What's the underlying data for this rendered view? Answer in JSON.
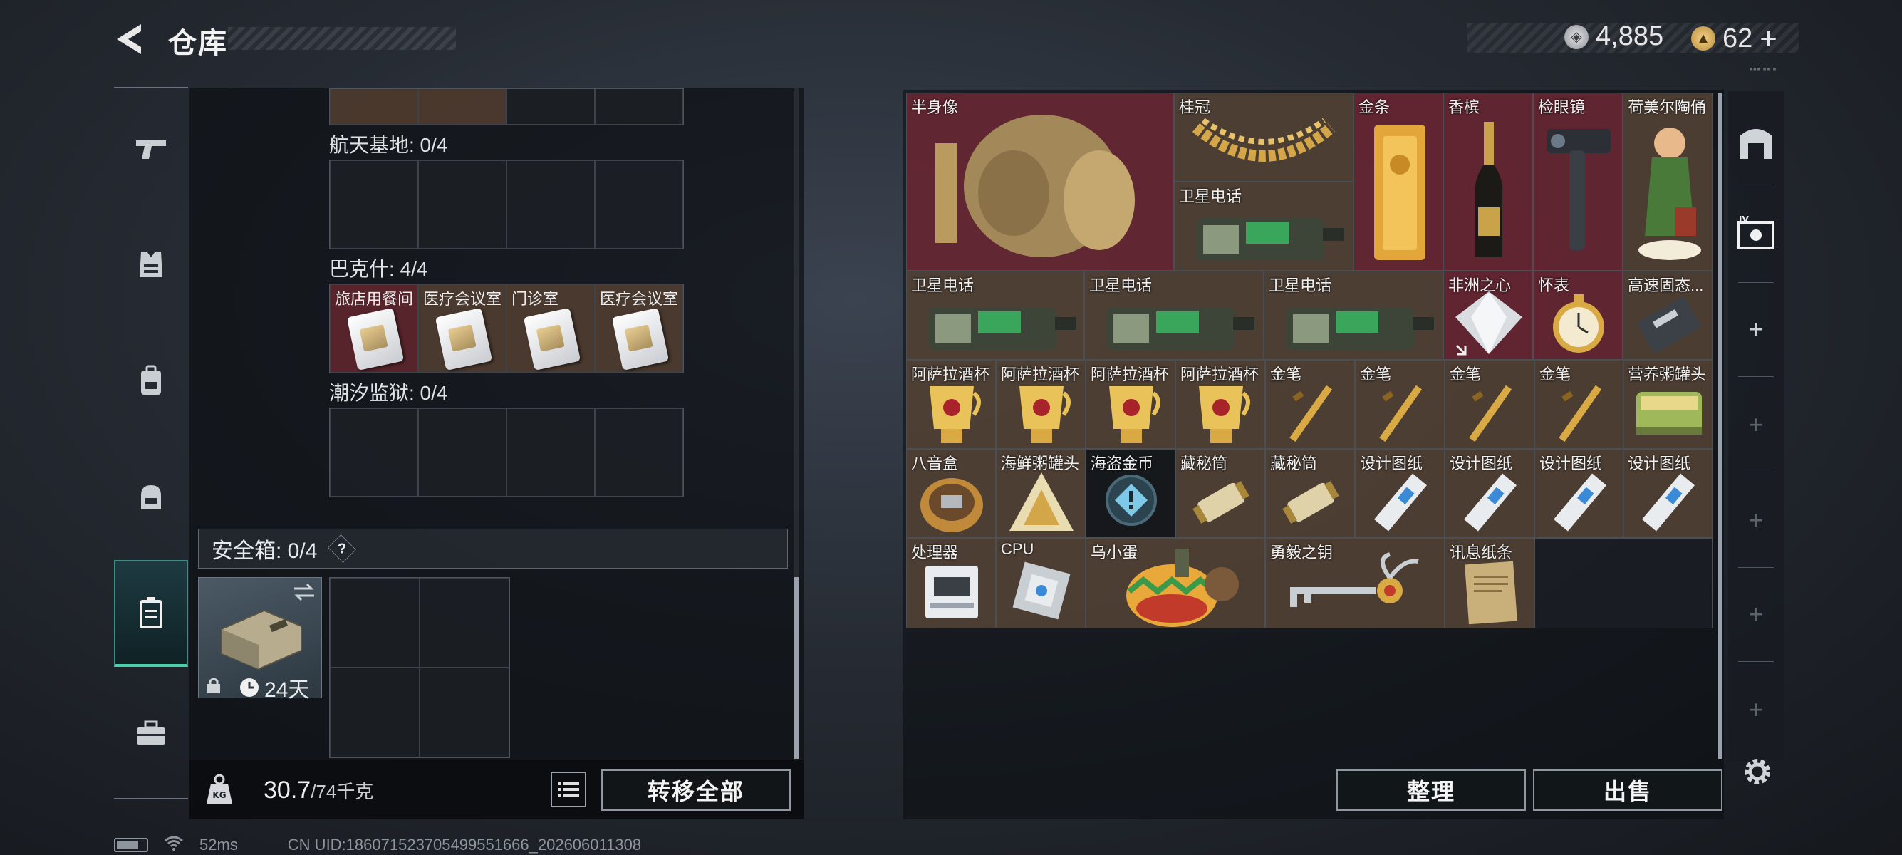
{
  "header": {
    "title": "仓库",
    "silver_amount": "4,885",
    "gold_amount": "62",
    "plus_symbol": "+"
  },
  "nav": {
    "items": [
      {
        "name": "weapons",
        "icon": "gun-icon"
      },
      {
        "name": "armor",
        "icon": "armor-vest-icon"
      },
      {
        "name": "backpack",
        "icon": "backpack-icon"
      },
      {
        "name": "helmet-bag",
        "icon": "helmet-icon"
      },
      {
        "name": "keycards",
        "icon": "keycard-case-icon",
        "active": true
      },
      {
        "name": "toolbox",
        "icon": "toolbox-icon"
      }
    ]
  },
  "keycard_panel": {
    "sections": [
      {
        "label": "航天基地: 0/4",
        "slots": [
          "",
          "",
          "",
          ""
        ]
      },
      {
        "label": "巴克什: 4/4",
        "slots": [
          "旅店用餐间",
          "医疗会议室",
          "门诊室",
          "医疗会议室"
        ]
      },
      {
        "label": "潮汐监狱: 0/4",
        "slots": [
          "",
          "",
          "",
          ""
        ]
      }
    ],
    "safe": {
      "label": "安全箱: 0/4",
      "help": "?",
      "timer": "24天"
    },
    "weight_value": "30.7",
    "weight_max": "/74千克",
    "transfer_all": "转移全部"
  },
  "storage": {
    "items": [
      {
        "name": "半身像",
        "color": "red"
      },
      {
        "name": "桂冠",
        "color": "brown"
      },
      {
        "name": "卫星电话",
        "color": "brown"
      },
      {
        "name": "金条",
        "color": "red"
      },
      {
        "name": "香槟",
        "color": "red"
      },
      {
        "name": "检眼镜",
        "color": "red"
      },
      {
        "name": "荷美尔陶俑",
        "color": "brown"
      },
      {
        "name": "卫星电话",
        "color": "brown"
      },
      {
        "name": "卫星电话",
        "color": "brown"
      },
      {
        "name": "卫星电话",
        "color": "brown"
      },
      {
        "name": "非洲之心",
        "color": "red"
      },
      {
        "name": "怀表",
        "color": "red"
      },
      {
        "name": "高速固态...",
        "color": "brown"
      },
      {
        "name": "阿萨拉酒杯",
        "color": "brown"
      },
      {
        "name": "阿萨拉酒杯",
        "color": "brown"
      },
      {
        "name": "阿萨拉酒杯",
        "color": "brown"
      },
      {
        "name": "阿萨拉酒杯",
        "color": "brown"
      },
      {
        "name": "金笔",
        "color": "brown"
      },
      {
        "name": "金笔",
        "color": "brown"
      },
      {
        "name": "金笔",
        "color": "brown"
      },
      {
        "name": "金笔",
        "color": "brown"
      },
      {
        "name": "营养粥罐头",
        "color": "brown"
      },
      {
        "name": "八音盒",
        "color": "brown"
      },
      {
        "name": "海鲜粥罐头",
        "color": "brown"
      },
      {
        "name": "海盗金币",
        "color": "dark"
      },
      {
        "name": "藏秘筒",
        "color": "brown"
      },
      {
        "name": "藏秘筒",
        "color": "brown"
      },
      {
        "name": "设计图纸",
        "color": "brown"
      },
      {
        "name": "设计图纸",
        "color": "brown"
      },
      {
        "name": "设计图纸",
        "color": "brown"
      },
      {
        "name": "设计图纸",
        "color": "brown"
      },
      {
        "name": "处理器",
        "color": "brown"
      },
      {
        "name": "CPU",
        "color": "brown"
      },
      {
        "name": "乌小蛋",
        "color": "brown"
      },
      {
        "name": "勇毅之钥",
        "color": "brown"
      },
      {
        "name": "讯息纸条",
        "color": "brown"
      }
    ],
    "sort_label": "整理",
    "sell_label": "出售"
  },
  "status_bar": {
    "ping": "52ms",
    "uid": "CN UID:186071523705499551666_202606011308"
  }
}
